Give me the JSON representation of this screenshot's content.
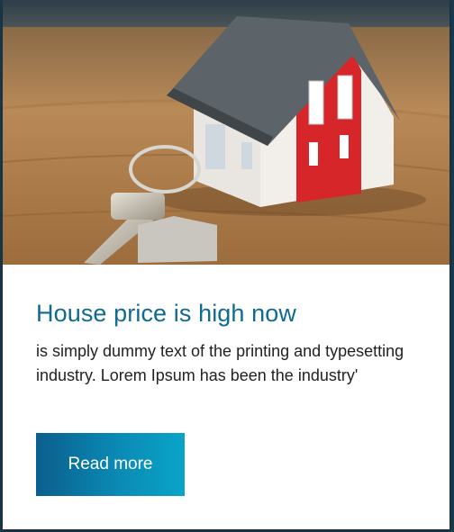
{
  "card": {
    "title": "House price is high now",
    "description": "is simply dummy text of the printing and typesetting industry. Lorem Ipsum has been the industry'",
    "button_label": "Read more"
  },
  "colors": {
    "title": "#0f6a92",
    "button_gradient": [
      "#0b5e8c",
      "#0aa4c8"
    ],
    "page_background": "#1b3b4e"
  }
}
